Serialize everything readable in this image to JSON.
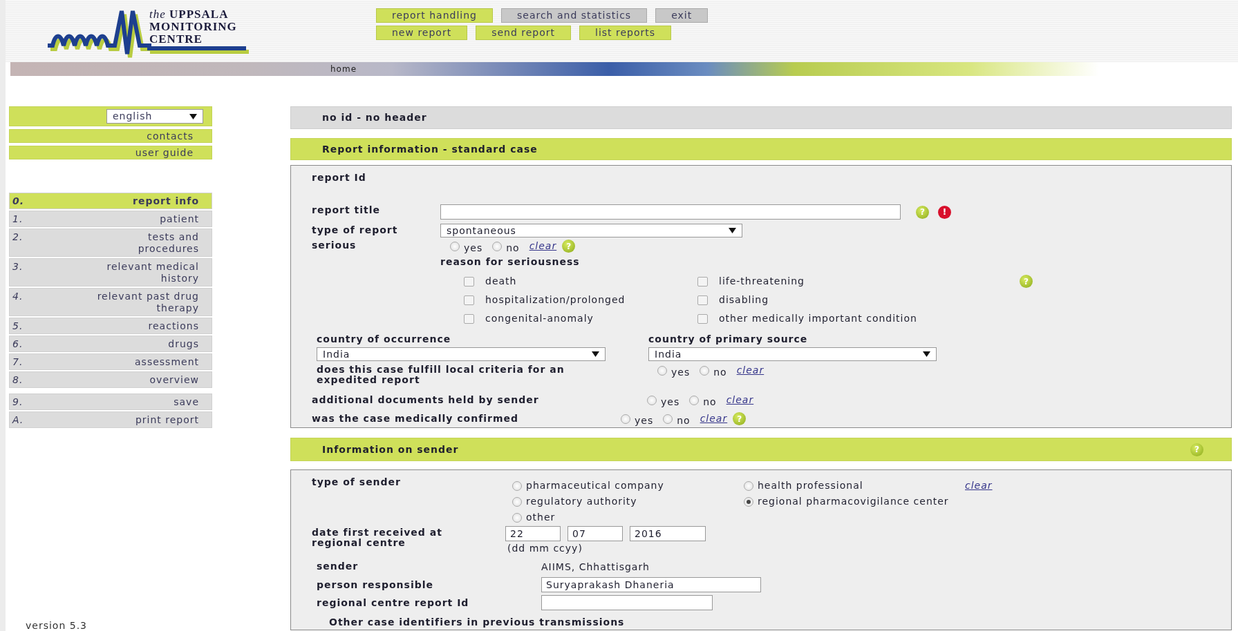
{
  "logo": {
    "prefix": "the",
    "line1": "UPPSALA",
    "line2": "MONITORING",
    "line3": "CENTRE"
  },
  "top_nav": [
    {
      "label": "report handling",
      "selected": true
    },
    {
      "label": "search and statistics",
      "selected": false
    },
    {
      "label": "exit",
      "selected": false
    }
  ],
  "sub_nav": [
    {
      "label": "new report"
    },
    {
      "label": "send report"
    },
    {
      "label": "list reports"
    }
  ],
  "breadcrumb": "home",
  "sidebar": {
    "language": "english",
    "links": [
      "contacts",
      "user guide"
    ],
    "steps": [
      {
        "number": "0.",
        "label": "report info",
        "selected": true
      },
      {
        "number": "1.",
        "label": "patient",
        "selected": false
      },
      {
        "number": "2.",
        "label": "tests and procedures",
        "selected": false
      },
      {
        "number": "3.",
        "label": "relevant medical history",
        "selected": false
      },
      {
        "number": "4.",
        "label": "relevant past drug therapy",
        "selected": false
      },
      {
        "number": "5.",
        "label": "reactions",
        "selected": false
      },
      {
        "number": "6.",
        "label": "drugs",
        "selected": false
      },
      {
        "number": "7.",
        "label": "assessment",
        "selected": false
      },
      {
        "number": "8.",
        "label": "overview",
        "selected": false
      }
    ],
    "actions": [
      {
        "number": "9.",
        "label": "save"
      },
      {
        "number": "A.",
        "label": "print report"
      }
    ],
    "version": "version 5.3"
  },
  "case_header": "no id - no header",
  "report_section": {
    "title": "Report information - standard case",
    "report_id_label": "report Id",
    "report_title": {
      "label": "report title",
      "help": "?",
      "alert": "!"
    },
    "type_of_report": {
      "label": "type of report",
      "value": "spontaneous"
    },
    "serious": {
      "label": "serious",
      "options": [
        {
          "label": "yes",
          "selected": false
        },
        {
          "label": "no",
          "selected": false
        }
      ],
      "clear": "clear",
      "help": "?"
    },
    "seriousness": {
      "title": "reason for seriousness",
      "help": "?",
      "items": [
        {
          "label": "death",
          "checked": false
        },
        {
          "label": "life-threatening",
          "checked": false
        },
        {
          "label": "hospitalization/prolonged",
          "checked": false
        },
        {
          "label": "disabling",
          "checked": false
        },
        {
          "label": "congenital-anomaly",
          "checked": false
        },
        {
          "label": "other medically important condition",
          "checked": false
        }
      ]
    },
    "country_of_occurrence": {
      "label": "country of occurrence",
      "value": "India"
    },
    "country_of_primary_source": {
      "label": "country of primary source",
      "value": "India"
    },
    "expedited": {
      "label": "does this case fulfill local criteria for an expedited report",
      "options": [
        {
          "label": "yes",
          "selected": false
        },
        {
          "label": "no",
          "selected": false
        }
      ],
      "clear": "clear"
    },
    "additional_documents": {
      "label": "additional documents held by sender",
      "options": [
        {
          "label": "yes",
          "selected": false
        },
        {
          "label": "no",
          "selected": false
        }
      ],
      "clear": "clear"
    },
    "medically_confirmed": {
      "label": "was the case medically confirmed",
      "options": [
        {
          "label": "yes",
          "selected": false
        },
        {
          "label": "no",
          "selected": false
        }
      ],
      "clear": "clear",
      "help": "?"
    }
  },
  "sender_section": {
    "title": "Information on sender",
    "help": "?",
    "type_of_sender": {
      "label": "type of sender",
      "clear": "clear",
      "options": [
        {
          "label": "pharmaceutical company",
          "selected": false
        },
        {
          "label": "health professional",
          "selected": false
        },
        {
          "label": "regulatory authority",
          "selected": false
        },
        {
          "label": "regional pharmacovigilance center",
          "selected": true
        },
        {
          "label": "other",
          "selected": false
        }
      ]
    },
    "date_received": {
      "label": "date first received at regional centre",
      "day": "22",
      "month": "07",
      "year": "2016",
      "hint": "(dd mm ccyy)"
    },
    "sender": {
      "label": "sender",
      "value": "AIIMS, Chhattisgarh"
    },
    "person_responsible": {
      "label": "person responsible",
      "value": "Suryaprakash Dhaneria"
    },
    "regional_report_id": {
      "label": "regional centre report Id"
    },
    "other_identifiers_title": "Other case identifiers in previous transmissions"
  }
}
